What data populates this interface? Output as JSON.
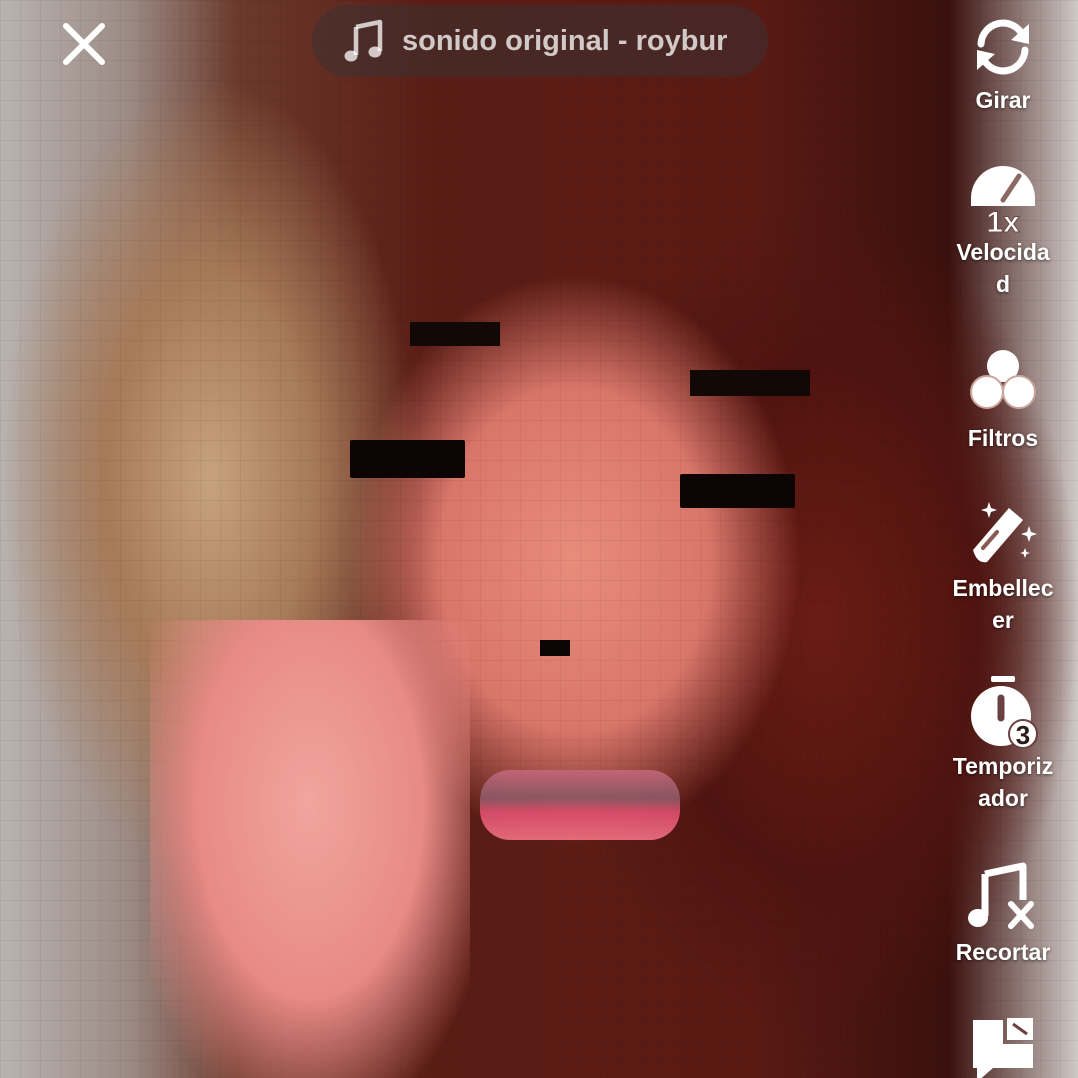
{
  "top_bar": {
    "close_icon": "close-icon",
    "sound_icon": "music-note-icon",
    "sound_label": "sonido original - roybur"
  },
  "toolbar": {
    "items": [
      {
        "label": "Girar",
        "icon": "flip-camera-icon"
      },
      {
        "label": "Velocidad",
        "icon": "speed-gauge-icon",
        "badge": "1x"
      },
      {
        "label": "Filtros",
        "icon": "filters-icon"
      },
      {
        "label": "Embellecer",
        "icon": "beauty-wand-icon"
      },
      {
        "label": "Temporizador",
        "icon": "timer-icon",
        "badge": "3"
      },
      {
        "label": "Recortar",
        "icon": "trim-sound-icon"
      },
      {
        "label": "",
        "icon": "more-icon"
      }
    ]
  },
  "colors": {
    "toolbar_text": "#ffffff",
    "pill_background": "rgba(60, 50, 50, 0.55)"
  }
}
